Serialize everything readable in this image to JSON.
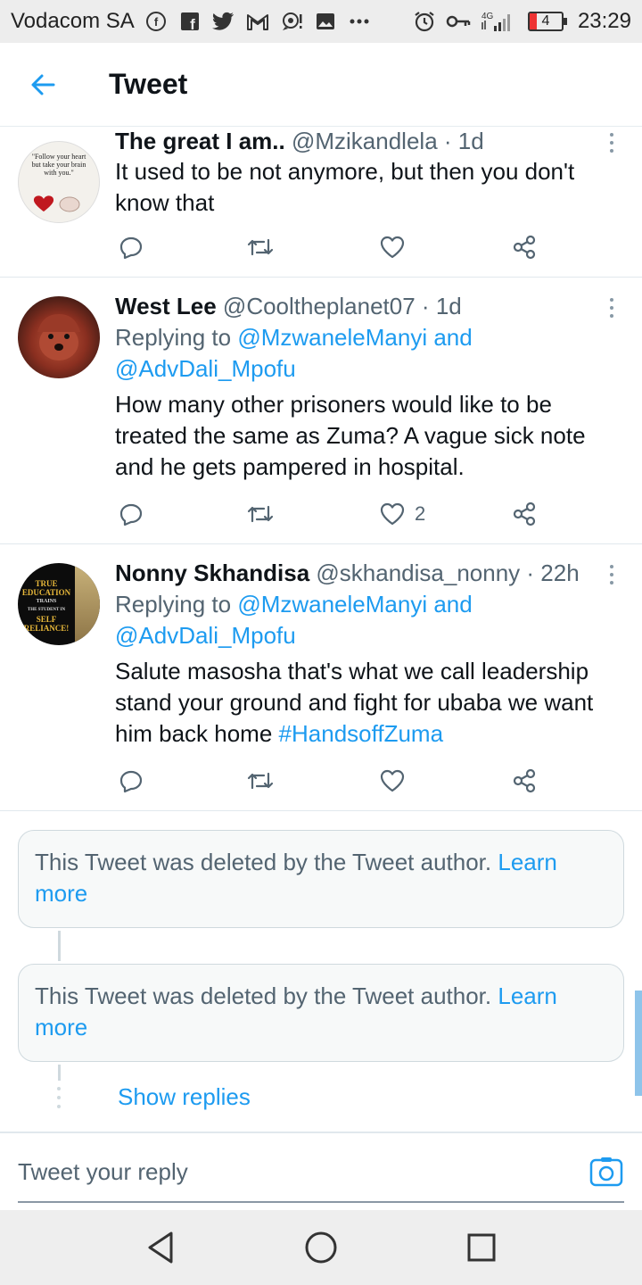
{
  "status_bar": {
    "carrier": "Vodacom SA",
    "network": "4G",
    "battery": "4",
    "time": "23:29",
    "icons": [
      "facebook-circle-icon",
      "facebook-icon",
      "twitter-icon",
      "gmail-icon",
      "chat-icon",
      "gallery-icon",
      "more-notifications-icon",
      "alarm-icon",
      "vpn-key-icon",
      "signal-icon"
    ]
  },
  "nav": {
    "title": "Tweet",
    "back_icon": "back-arrow-icon"
  },
  "tweets": [
    {
      "name": "The great I am..",
      "handle": "@Mzikandlela",
      "sep": " · ",
      "time": "1d",
      "text": "It used to be not anymore, but then you don't know that",
      "avatar_text": "\"Follow your heart but take your brain with you.\"",
      "likes": ""
    },
    {
      "name": "West Lee",
      "handle": "@Cooltheplanet07",
      "sep": " · ",
      "time": "1d",
      "replying_prefix": "Replying to ",
      "replying_user1": "@MzwaneleManyi",
      "replying_and": " and",
      "replying_user2": "@AdvDali_Mpofu",
      "text": "How many other prisoners would like to be treated the same as Zuma? A vague sick note and he gets pampered in hospital.",
      "likes": "2"
    },
    {
      "name": "Nonny Skhandisa",
      "handle": "@skhandisa_nonny",
      "sep": " · ",
      "time": "22h",
      "replying_prefix": "Replying to ",
      "replying_user1": "@MzwaneleManyi",
      "replying_and": " and",
      "replying_user2": "@AdvDali_Mpofu",
      "text": "Salute masosha that's what we call leadership stand your ground and fight for ubaba we want him back home ",
      "hashtag": "#HandsoffZuma",
      "avatar_lines": [
        "TRUE",
        "EDUCATION",
        "TRAINS",
        "THE STUDENT IN",
        "SELF",
        "RELIANCE!"
      ],
      "likes": ""
    }
  ],
  "deleted_notices": [
    {
      "text": "This Tweet was deleted by the Tweet author. ",
      "learn": "Learn more"
    },
    {
      "text": "This Tweet was deleted by the Tweet author. ",
      "learn": "Learn more"
    }
  ],
  "show_replies": "Show replies",
  "compose": {
    "placeholder": "Tweet your reply",
    "camera_icon": "camera-icon"
  },
  "system_nav": {
    "icons": [
      "back-triangle-icon",
      "home-circle-icon",
      "recents-square-icon"
    ]
  },
  "colors": {
    "accent": "#1d9bf0",
    "secondary_text": "#536471",
    "border": "#e1e8ed"
  }
}
